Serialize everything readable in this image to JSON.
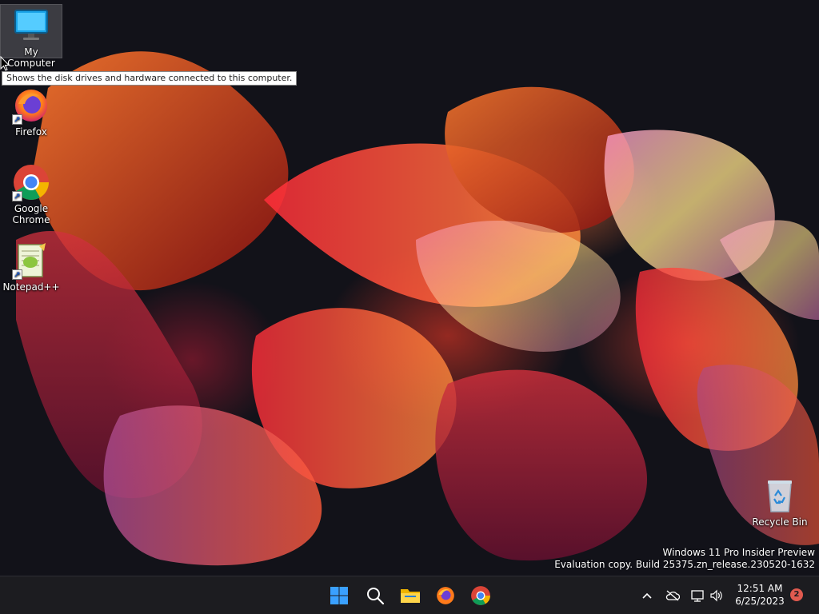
{
  "desktop": {
    "icons": [
      {
        "label": "My Computer",
        "icon": "monitor-icon"
      },
      {
        "label": "Firefox",
        "icon": "firefox-icon"
      },
      {
        "label": "Google Chrome",
        "icon": "chrome-icon"
      },
      {
        "label": "Notepad++",
        "icon": "notepad-plus-plus-icon"
      },
      {
        "label": "Recycle Bin",
        "icon": "recycle-bin-icon"
      }
    ],
    "tooltip": "Shows the disk drives and hardware connected to this computer.",
    "watermark": {
      "line1": "Windows 11 Pro Insider Preview",
      "line2": "Evaluation copy. Build 25375.zn_release.230520-1632"
    }
  },
  "taskbar": {
    "apps": [
      {
        "icon": "windows-start-icon"
      },
      {
        "icon": "search-icon"
      },
      {
        "icon": "file-explorer-icon"
      },
      {
        "icon": "firefox-icon"
      },
      {
        "icon": "chrome-icon"
      }
    ],
    "tray": {
      "icons": [
        "chevron-up-icon",
        "cloud-offline-icon",
        "network-icon",
        "volume-icon"
      ],
      "time": "12:51 AM",
      "date": "6/25/2023",
      "notification_count": "2"
    }
  },
  "colors": {
    "taskbar_bg": "#1c1c20",
    "start_blue": "#1e90ff",
    "badge": "#e05a4f"
  }
}
